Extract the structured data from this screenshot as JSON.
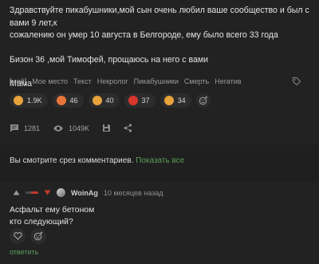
{
  "post": {
    "lines": [
      "Здравствуйте пикабушники,мой сын очень любил ваше сообщество и был с вами 9 лет,к",
      "сожалению он умер 10 августа в Белгороде, ему было всего 33 года",
      "Бизон 36 ,мой Тимофей, прощаюсь на него с вами",
      "Мама"
    ],
    "tags": [
      "[моё]",
      "Мое место",
      "Текст",
      "Некролог",
      "Пикабушники",
      "Смерть",
      "Негатив"
    ],
    "reactions": [
      {
        "icon": "crying-face-icon",
        "count": "1.9K",
        "color": "#e8a33b"
      },
      {
        "icon": "sad-face-icon",
        "count": "46",
        "color": "#e8743b"
      },
      {
        "icon": "hug-face-icon",
        "count": "40",
        "color": "#e8a33b"
      },
      {
        "icon": "angry-face-icon",
        "count": "37",
        "color": "#d9362b"
      },
      {
        "icon": "thinking-face-icon",
        "count": "34",
        "color": "#e8a33b"
      }
    ],
    "stats": {
      "comments": "1281",
      "views": "1049K"
    }
  },
  "view_note": {
    "text": "Вы смотрите срез комментариев.",
    "link": "Показать все"
  },
  "comment": {
    "author": "WoinAg",
    "time": "10 месяцев назад",
    "rating_negative_share": 0.55,
    "lines": [
      "Асфальт ему бетоном",
      "кто следующий?"
    ],
    "reply_label": "ответить"
  },
  "colors": {
    "accent": "#5c9e5a",
    "background": "#1f1f1f",
    "card": "#222222"
  }
}
